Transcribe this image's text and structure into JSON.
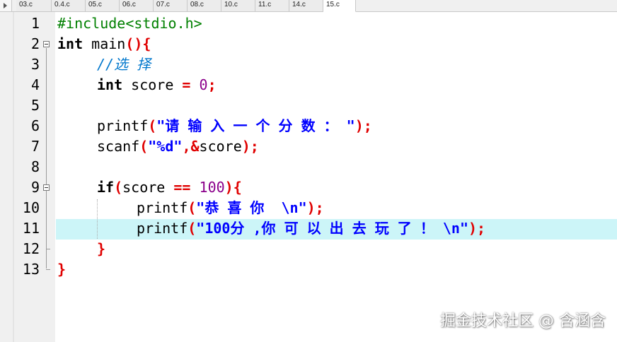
{
  "tabs": [
    "03.c",
    "0.4.c",
    "05.c",
    "06.c",
    "07.c",
    "08.c",
    "10.c",
    "11.c",
    "14.c",
    "15.c"
  ],
  "active_tab": "15.c",
  "lines": [
    {
      "n": "1"
    },
    {
      "n": "2"
    },
    {
      "n": "3"
    },
    {
      "n": "4"
    },
    {
      "n": "5"
    },
    {
      "n": "6"
    },
    {
      "n": "7"
    },
    {
      "n": "8"
    },
    {
      "n": "9"
    },
    {
      "n": "10"
    },
    {
      "n": "11"
    },
    {
      "n": "12"
    },
    {
      "n": "13"
    }
  ],
  "code": {
    "l1_pp": "#include<stdio.h>",
    "l2_kw": "int",
    "l2_fn": " main",
    "l2_br": "(){",
    "l3_cmt": "//选 择",
    "l4_kw": "int",
    "l4_id": " score ",
    "l4_op": "=",
    "l4_num": " 0",
    "l4_semi": ";",
    "l6_fn": "printf",
    "l6_open": "(",
    "l6_str": "\"请 输 入 一 个 分 数 ： \"",
    "l6_close": ");",
    "l7_fn": "scanf",
    "l7_open": "(",
    "l7_str": "\"%d\"",
    "l7_mid": ",&",
    "l7_id": "score",
    "l7_close": ");",
    "l9_kw": "if",
    "l9_open": "(",
    "l9_id": "score ",
    "l9_op": "==",
    "l9_num": " 100",
    "l9_close": "){",
    "l10_fn": "printf",
    "l10_open": "(",
    "l10_str": "\"恭 喜 你  \\n\"",
    "l10_close": ");",
    "l11_fn": "printf",
    "l11_open": "(",
    "l11_str": "\"100分 ,你 可 以 出 去 玩 了 ！ \\n\"",
    "l11_close": ");",
    "l12_br": "}",
    "l13_br": "}"
  },
  "current_line": "11",
  "watermark": "掘金技术社区 @ 含涵含",
  "colors": {
    "preprocessor": "#008000",
    "bracket": "#e00000",
    "number": "#8b008b",
    "string": "#0000ff",
    "comment": "#0077cc",
    "current_line_bg": "#ccf5f8"
  }
}
